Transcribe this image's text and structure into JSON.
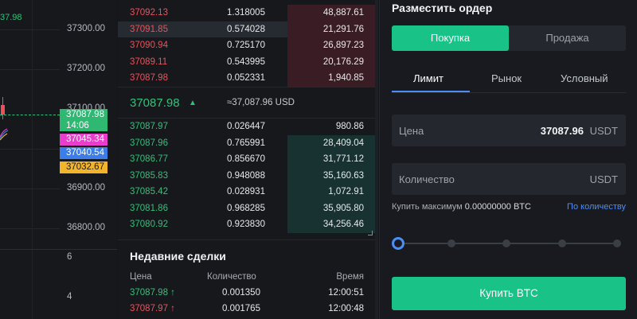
{
  "chart": {
    "top_value": "37.98",
    "price_ticks": [
      "37300.00",
      "37200.00",
      "37100.00",
      "36900.00",
      "36800.00"
    ],
    "volume_ticks": [
      "6",
      "4"
    ],
    "tags": {
      "last_price": "37087.98",
      "countdown": "14:06",
      "ma1": "37045.34",
      "ma2": "37040.54",
      "ma3": "37032.67"
    },
    "colors": {
      "up": "#2fc27a",
      "down": "#ef4f57",
      "ma1": "#e83ecb",
      "ma2": "#3b7dea",
      "ma3": "#f2b42a"
    }
  },
  "orderbook": {
    "asks": [
      {
        "price": "37092.13",
        "qty": "1.318005",
        "total": "48,887.61",
        "depth": 0.34
      },
      {
        "price": "37091.85",
        "qty": "0.574028",
        "total": "21,291.76",
        "depth": 0.34
      },
      {
        "price": "37090.94",
        "qty": "0.725170",
        "total": "26,897.23",
        "depth": 0.34
      },
      {
        "price": "37089.11",
        "qty": "0.543995",
        "total": "20,176.29",
        "depth": 0.34
      },
      {
        "price": "37087.98",
        "qty": "0.052331",
        "total": "1,940.85",
        "depth": 0.34
      }
    ],
    "mid": {
      "price": "37087.98",
      "usd": "≈37,087.96 USD"
    },
    "bids": [
      {
        "price": "37087.97",
        "qty": "0.026447",
        "total": "980.86",
        "depth": 0.0
      },
      {
        "price": "37087.96",
        "qty": "0.765991",
        "total": "28,409.04",
        "depth": 0.34
      },
      {
        "price": "37086.77",
        "qty": "0.856670",
        "total": "31,771.12",
        "depth": 0.34
      },
      {
        "price": "37085.83",
        "qty": "0.948088",
        "total": "35,160.63",
        "depth": 0.34
      },
      {
        "price": "37085.42",
        "qty": "0.028931",
        "total": "1,072.91",
        "depth": 0.34
      },
      {
        "price": "37081.86",
        "qty": "0.968285",
        "total": "35,905.80",
        "depth": 0.34
      },
      {
        "price": "37080.92",
        "qty": "0.923830",
        "total": "34,256.46",
        "depth": 0.34
      }
    ]
  },
  "trades": {
    "title": "Недавние сделки",
    "headers": {
      "price": "Цена",
      "qty": "Количество",
      "time": "Время"
    },
    "rows": [
      {
        "price": "37087.98",
        "arrow": "↑",
        "dir": "up",
        "qty": "0.001350",
        "time": "12:00:51"
      },
      {
        "price": "37087.97",
        "arrow": "↑",
        "dir": "down",
        "qty": "0.001765",
        "time": "12:00:48"
      }
    ]
  },
  "order_form": {
    "title": "Разместить ордер",
    "buy_tab": "Покупка",
    "sell_tab": "Продажа",
    "type_tabs": [
      "Лимит",
      "Рынок",
      "Условный"
    ],
    "price_label": "Цена",
    "price_value": "37087.96",
    "price_unit": "USDT",
    "qty_label": "Количество",
    "qty_unit": "USDT",
    "max_buy_label": "Купить максимум",
    "max_buy_value": "0.00000000 BTC",
    "by_qty_link": "По количеству",
    "slider_value_percent": 0,
    "buy_button": "Купить BTC",
    "accent": "#19c286",
    "link_color": "#4c8df6"
  }
}
